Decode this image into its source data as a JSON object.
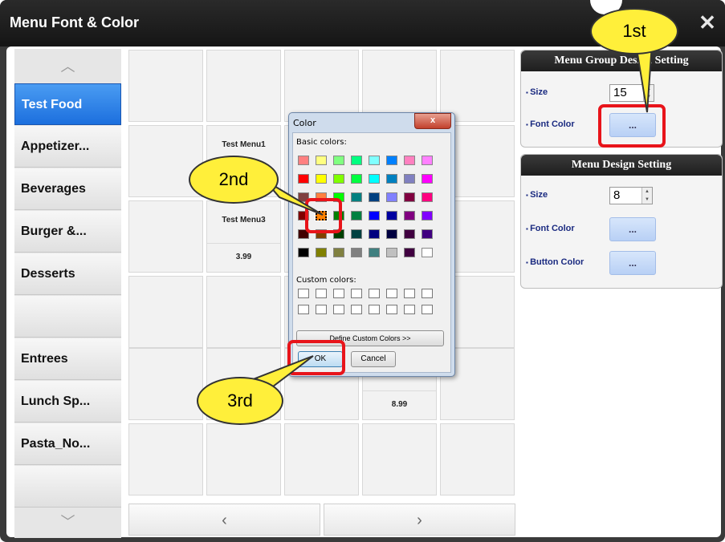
{
  "window": {
    "title": "Menu Font & Color",
    "close_glyph": "✕"
  },
  "sidebar": {
    "up_glyph": "︿",
    "down_glyph": "﹀",
    "items": [
      {
        "label": "Test Food",
        "active": true
      },
      {
        "label": "Appetizer..."
      },
      {
        "label": "Beverages"
      },
      {
        "label": "Burger &..."
      },
      {
        "label": "Desserts"
      },
      {
        "label": ""
      },
      {
        "label": "Entrees"
      },
      {
        "label": "Lunch Sp..."
      },
      {
        "label": "Pasta_No..."
      },
      {
        "label": ""
      }
    ]
  },
  "grid": {
    "items": {
      "test_menu1": {
        "name": "Test Menu1"
      },
      "test_menu3": {
        "name": "Test Menu3",
        "price": "3.99"
      },
      "item_price_899": {
        "price": "8.99"
      }
    },
    "nav": {
      "prev_glyph": "‹",
      "next_glyph": "›"
    }
  },
  "menu_group_panel": {
    "title": "Menu Group Design Setting",
    "size_label": "Size",
    "size_value": "15",
    "font_color_label": "Font Color",
    "font_color_button": "..."
  },
  "menu_design_panel": {
    "title": "Menu Design Setting",
    "size_label": "Size",
    "size_value": "8",
    "font_color_label": "Font Color",
    "font_color_button": "...",
    "button_color_label": "Button Color",
    "button_color_button": "..."
  },
  "color_dialog": {
    "title": "Color",
    "close_glyph": "x",
    "basic_colors_label": "Basic colors:",
    "custom_colors_label": "Custom colors:",
    "define_button": "Define Custom Colors >>",
    "ok_button": "OK",
    "cancel_button": "Cancel",
    "basic_colors": [
      [
        "#ff8080",
        "#ffff80",
        "#80ff80",
        "#00ff80",
        "#80ffff",
        "#0080ff",
        "#ff80c0",
        "#ff80ff"
      ],
      [
        "#ff0000",
        "#ffff00",
        "#80ff00",
        "#00ff40",
        "#00ffff",
        "#0080c0",
        "#8080c0",
        "#ff00ff"
      ],
      [
        "#804040",
        "#ff8040",
        "#00ff00",
        "#008080",
        "#004080",
        "#8080ff",
        "#800040",
        "#ff0080"
      ],
      [
        "#800000",
        "#ff8000",
        "#008000",
        "#008040",
        "#0000ff",
        "#0000a0",
        "#800080",
        "#8000ff"
      ],
      [
        "#400000",
        "#804000",
        "#004000",
        "#004040",
        "#000080",
        "#000040",
        "#400040",
        "#400080"
      ],
      [
        "#000000",
        "#808000",
        "#808040",
        "#808080",
        "#408080",
        "#c0c0c0",
        "#400040",
        "#ffffff"
      ]
    ],
    "selected_color": "#ff8000"
  },
  "annotations": {
    "first": "1st",
    "second": "2nd",
    "third": "3rd",
    "highlight_color": "#e8141a",
    "callout_color": "#ffef3a"
  }
}
